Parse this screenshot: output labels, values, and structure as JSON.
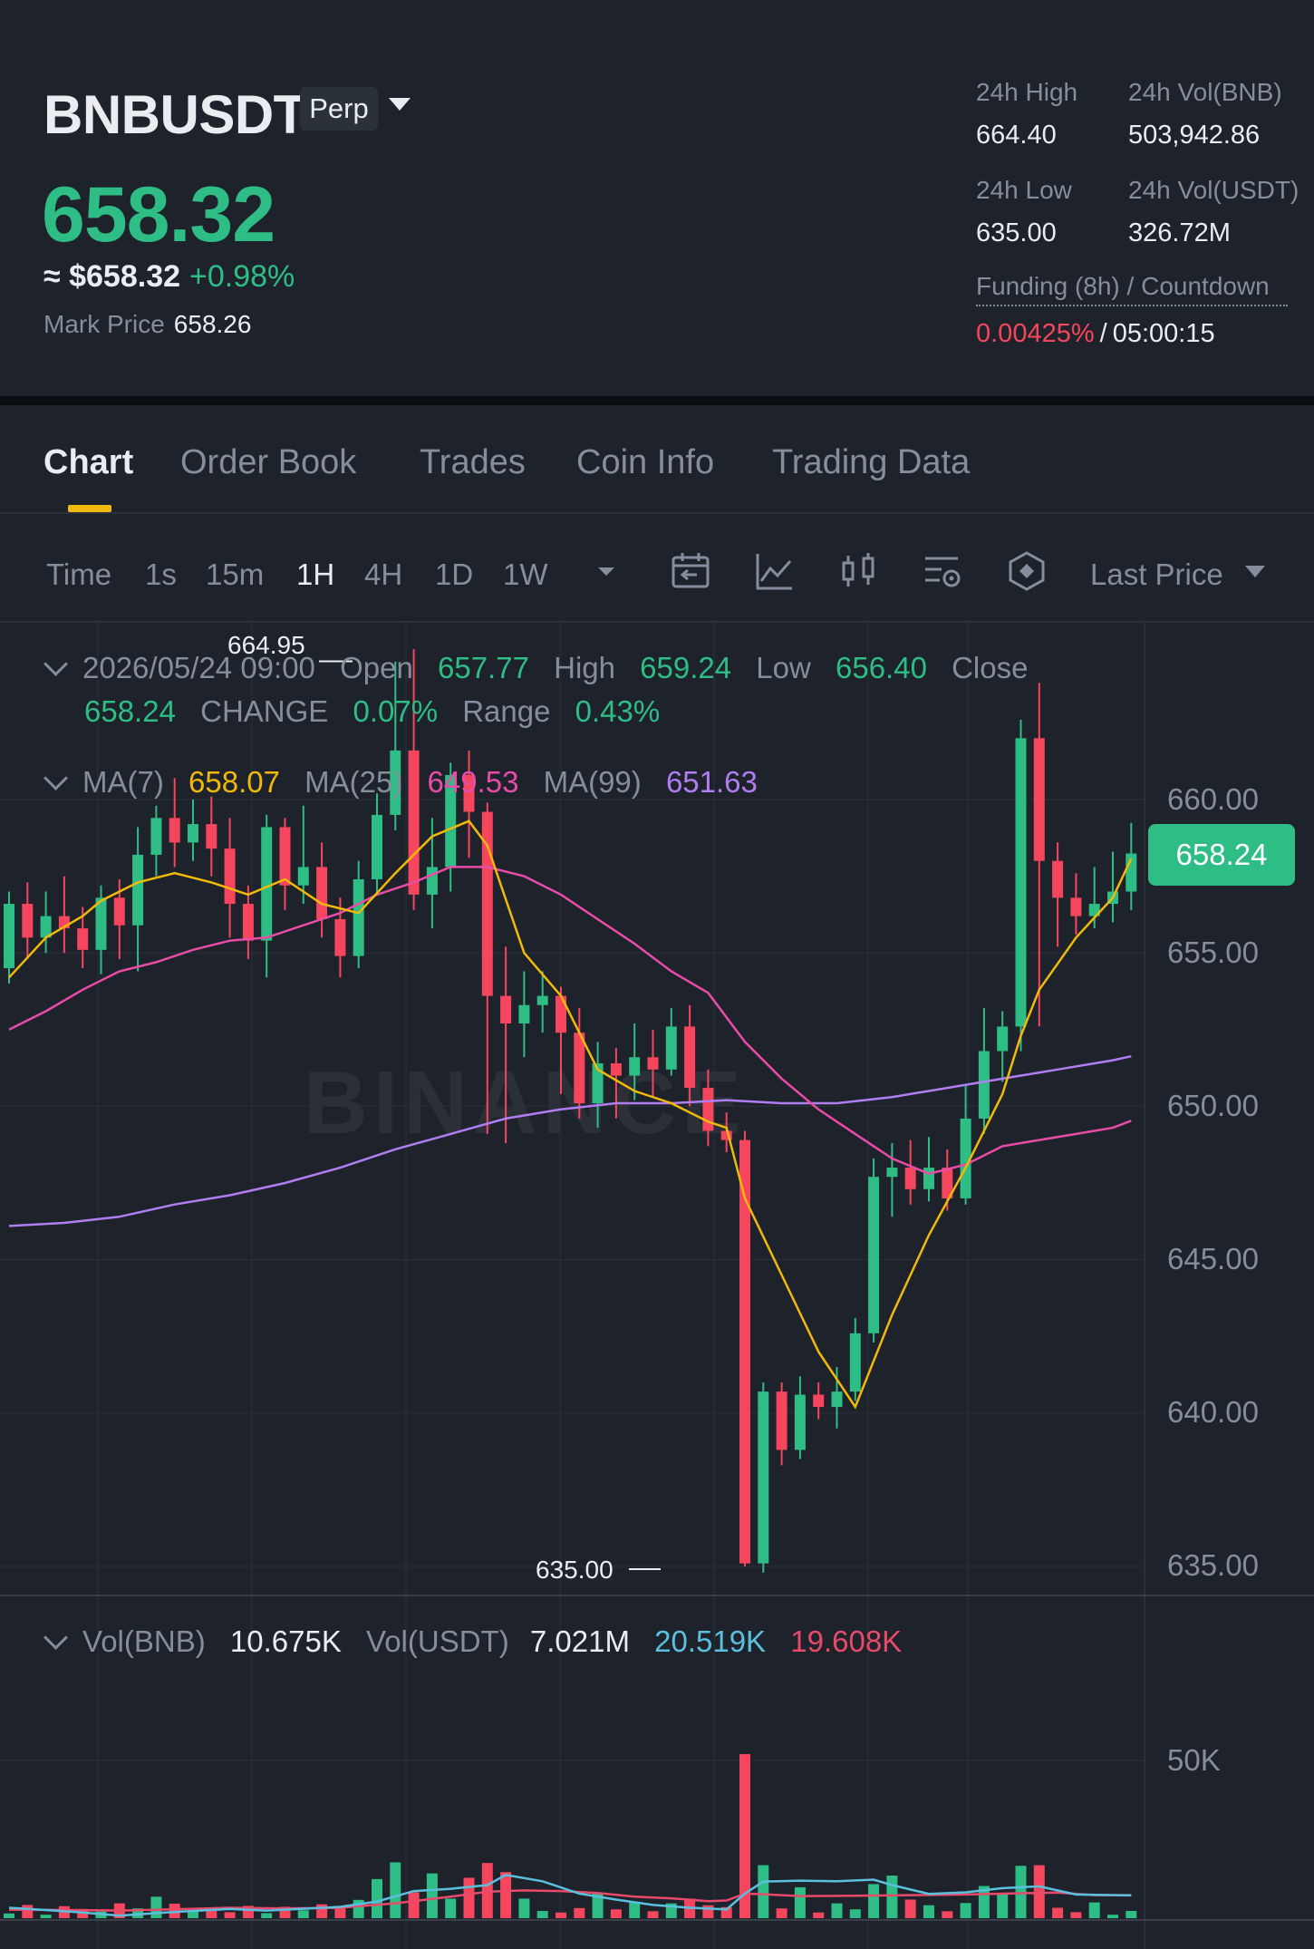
{
  "header": {
    "symbol": "BNBUSDT",
    "contract_type": "Perp",
    "last_price": "658.32",
    "usd_price": "≈ $658.32",
    "change_pct": "+0.98%",
    "mark_price_label": "Mark Price",
    "mark_price": "658.26"
  },
  "stats": {
    "high_label": "24h High",
    "high": "664.40",
    "vol_bnb_label": "24h Vol(BNB)",
    "vol_bnb": "503,942.86",
    "low_label": "24h Low",
    "low": "635.00",
    "vol_usdt_label": "24h Vol(USDT)",
    "vol_usdt": "326.72M",
    "funding_label": "Funding (8h) / Countdown",
    "funding_rate": "0.00425%",
    "funding_sep": "/",
    "countdown": "05:00:15"
  },
  "tabs": [
    "Chart",
    "Order Book",
    "Trades",
    "Coin Info",
    "Trading Data"
  ],
  "toolbar": {
    "timeframes": [
      "Time",
      "1s",
      "15m",
      "1H",
      "4H",
      "1D",
      "1W"
    ],
    "active_timeframe": "1H",
    "price_type": "Last Price",
    "icons": [
      "calendar-icon",
      "indicator-icon",
      "candle-type-icon",
      "settings-icon",
      "depth-icon"
    ]
  },
  "ohlc": {
    "datetime": "2026/05/24 09:00",
    "open_label": "Open",
    "open": "657.77",
    "high_label": "High",
    "high": "659.24",
    "low_label": "Low",
    "low": "656.40",
    "close_label": "Close",
    "close": "658.24",
    "change_label": "CHANGE",
    "change": "0.07%",
    "range_label": "Range",
    "range": "0.43%"
  },
  "ma": {
    "ma7_label": "MA(7)",
    "ma7": "658.07",
    "ma25_label": "MA(25)",
    "ma25": "649.53",
    "ma99_label": "MA(99)",
    "ma99": "651.63"
  },
  "volume_legend": {
    "vol_bnb_label": "Vol(BNB)",
    "vol_bnb": "10.675K",
    "vol_usdt_label": "Vol(USDT)",
    "vol_usdt": "7.021M",
    "ma_a": "20.519K",
    "ma_b": "19.608K"
  },
  "price_axis": [
    "660.00",
    "655.00",
    "650.00",
    "645.00",
    "640.00",
    "635.00"
  ],
  "volume_axis": [
    "50K"
  ],
  "current_price_tag": "658.24",
  "chart_high_label": "664.95",
  "chart_low_label": "635.00",
  "watermark": "BINANCE",
  "colors": {
    "up": "#2ebd85",
    "down": "#f6465d",
    "ma7": "#f0b90b",
    "ma25": "#e84ca7",
    "ma99": "#b07ef0",
    "vol_ma_a": "#5bc0de",
    "vol_ma_b": "#e84a6a"
  },
  "chart_data": {
    "type": "candlestick",
    "price_range": [
      634,
      666.5
    ],
    "volume_range": [
      0,
      55000
    ],
    "candles": [
      [
        654.5,
        656.6,
        654,
        657
      ],
      [
        656.6,
        655.5,
        654.8,
        657.3
      ],
      [
        655.5,
        656.2,
        655,
        657
      ],
      [
        656.2,
        655.8,
        655,
        657.5
      ],
      [
        655.8,
        655.1,
        654.5,
        656.5
      ],
      [
        655.1,
        656.8,
        654.3,
        657.2
      ],
      [
        656.8,
        655.9,
        654.8,
        657.4
      ],
      [
        655.9,
        658.2,
        654.4,
        659.1
      ],
      [
        658.2,
        659.4,
        657.5,
        659.8
      ],
      [
        659.4,
        658.6,
        657.8,
        660.7
      ],
      [
        658.6,
        659.2,
        658,
        660
      ],
      [
        659.2,
        658.4,
        657.5,
        660.1
      ],
      [
        658.4,
        656.6,
        655.5,
        659.4
      ],
      [
        656.6,
        655.4,
        654.8,
        657.2
      ],
      [
        655.4,
        659.1,
        654.2,
        659.5
      ],
      [
        659.1,
        657.2,
        656.4,
        659.4
      ],
      [
        657.2,
        657.8,
        656.6,
        659.8
      ],
      [
        657.8,
        656.1,
        655.5,
        658.6
      ],
      [
        656.1,
        654.9,
        654.2,
        656.8
      ],
      [
        654.9,
        657.4,
        654.5,
        658
      ],
      [
        657.4,
        659.5,
        656.9,
        660.2
      ],
      [
        659.5,
        661.6,
        659,
        664.5
      ],
      [
        661.6,
        656.9,
        656.4,
        664.9
      ],
      [
        656.9,
        657.8,
        655.8,
        659.4
      ],
      [
        657.8,
        660.8,
        657,
        661.2
      ],
      [
        660.8,
        659.6,
        658.1,
        661.6
      ],
      [
        659.6,
        653.6,
        649.1,
        659.9
      ],
      [
        653.6,
        652.7,
        648.8,
        655.2
      ],
      [
        652.7,
        653.3,
        651.6,
        654.4
      ],
      [
        653.3,
        653.6,
        652.4,
        654.4
      ],
      [
        653.6,
        652.4,
        650.4,
        653.9
      ],
      [
        652.4,
        650.1,
        649.6,
        653.2
      ],
      [
        650.1,
        651.4,
        649.3,
        652.1
      ],
      [
        651.4,
        651,
        649.6,
        651.9
      ],
      [
        651,
        651.6,
        650.2,
        652.7
      ],
      [
        651.6,
        651.2,
        650.3,
        652.5
      ],
      [
        651.2,
        652.6,
        651,
        653.2
      ],
      [
        652.6,
        650.6,
        650,
        653.3
      ],
      [
        650.6,
        649.2,
        648.7,
        651.2
      ],
      [
        649.2,
        648.9,
        648.5,
        649.8
      ],
      [
        648.9,
        635.1,
        635,
        649.2
      ],
      [
        635.1,
        640.7,
        634.8,
        641
      ],
      [
        640.7,
        638.8,
        638.3,
        641
      ],
      [
        638.8,
        640.6,
        638.5,
        641.2
      ],
      [
        640.6,
        640.2,
        639.8,
        641
      ],
      [
        640.2,
        640.7,
        639.5,
        641.5
      ],
      [
        640.7,
        642.6,
        640.4,
        643.1
      ],
      [
        642.6,
        647.7,
        642.3,
        648.3
      ],
      [
        647.7,
        648,
        646.4,
        648.8
      ],
      [
        648,
        647.3,
        646.8,
        648.9
      ],
      [
        647.3,
        648,
        646.9,
        649
      ],
      [
        648,
        647,
        646.6,
        648.6
      ],
      [
        647,
        649.6,
        646.8,
        650.7
      ],
      [
        649.6,
        651.8,
        649.1,
        653.2
      ],
      [
        651.8,
        652.6,
        650.8,
        653.1
      ],
      [
        652.6,
        662,
        651.8,
        662.6
      ],
      [
        662,
        658,
        652.6,
        663.8
      ],
      [
        658,
        656.8,
        655.2,
        658.6
      ],
      [
        656.8,
        656.2,
        655.6,
        657.6
      ],
      [
        656.2,
        656.6,
        655.8,
        657.8
      ],
      [
        656.6,
        657,
        656,
        658.3
      ],
      [
        657,
        658.24,
        656.4,
        659.24
      ]
    ],
    "volumes": [
      1500,
      4200,
      1100,
      3800,
      2900,
      2100,
      4700,
      3100,
      6800,
      4600,
      2400,
      2900,
      1900,
      3900,
      1600,
      3600,
      2500,
      4400,
      3100,
      5800,
      12400,
      17700,
      8200,
      14200,
      6200,
      12800,
      17500,
      14600,
      6200,
      2300,
      1800,
      3200,
      7800,
      2800,
      5200,
      2200,
      4700,
      6200,
      4100,
      3500,
      52000,
      16800,
      3100,
      9800,
      1800,
      4700,
      2800,
      10800,
      13500,
      5900,
      4100,
      2200,
      4800,
      10200,
      7600,
      16600,
      16800,
      3300,
      1900,
      5000,
      1100,
      2300
    ],
    "ma7": [
      [
        0,
        654.2
      ],
      [
        2,
        655.5
      ],
      [
        4,
        656.2
      ],
      [
        5,
        656.7
      ],
      [
        7,
        657.3
      ],
      [
        9,
        657.6
      ],
      [
        11,
        657.3
      ],
      [
        13,
        656.9
      ],
      [
        15,
        657.4
      ],
      [
        17,
        656.6
      ],
      [
        19,
        656.3
      ],
      [
        21,
        657.6
      ],
      [
        23,
        658.8
      ],
      [
        25,
        659.3
      ],
      [
        26,
        658.5
      ],
      [
        28,
        655
      ],
      [
        30,
        653.6
      ],
      [
        32,
        651.2
      ],
      [
        34,
        650.5
      ],
      [
        36,
        650.1
      ],
      [
        38,
        649.5
      ],
      [
        39,
        649.3
      ],
      [
        40,
        647
      ],
      [
        42,
        644.5
      ],
      [
        44,
        642
      ],
      [
        46,
        640.2
      ],
      [
        48,
        643.2
      ],
      [
        50,
        645.8
      ],
      [
        52,
        648
      ],
      [
        54,
        650.4
      ],
      [
        55,
        652.3
      ],
      [
        56,
        653.8
      ],
      [
        58,
        655.5
      ],
      [
        60,
        656.8
      ],
      [
        61,
        658.07
      ]
    ],
    "ma25": [
      [
        0,
        652.5
      ],
      [
        2,
        653.1
      ],
      [
        4,
        653.8
      ],
      [
        6,
        654.4
      ],
      [
        8,
        654.7
      ],
      [
        10,
        655.1
      ],
      [
        12,
        655.4
      ],
      [
        14,
        655.5
      ],
      [
        16,
        655.9
      ],
      [
        18,
        656.3
      ],
      [
        20,
        656.9
      ],
      [
        22,
        657.3
      ],
      [
        24,
        657.8
      ],
      [
        26,
        657.8
      ],
      [
        28,
        657.5
      ],
      [
        30,
        656.9
      ],
      [
        32,
        656.1
      ],
      [
        34,
        655.3
      ],
      [
        36,
        654.4
      ],
      [
        38,
        653.7
      ],
      [
        40,
        652.1
      ],
      [
        42,
        650.9
      ],
      [
        44,
        649.9
      ],
      [
        46,
        649.1
      ],
      [
        48,
        648.3
      ],
      [
        50,
        647.8
      ],
      [
        52,
        648.1
      ],
      [
        54,
        648.7
      ],
      [
        56,
        648.9
      ],
      [
        58,
        649.1
      ],
      [
        60,
        649.3
      ],
      [
        61,
        649.53
      ]
    ],
    "ma99": [
      [
        0,
        646.1
      ],
      [
        3,
        646.2
      ],
      [
        6,
        646.4
      ],
      [
        9,
        646.8
      ],
      [
        12,
        647.1
      ],
      [
        15,
        647.5
      ],
      [
        18,
        648
      ],
      [
        21,
        648.6
      ],
      [
        24,
        649.1
      ],
      [
        27,
        649.6
      ],
      [
        30,
        649.9
      ],
      [
        33,
        650.1
      ],
      [
        36,
        650.1
      ],
      [
        39,
        650.2
      ],
      [
        42,
        650.1
      ],
      [
        45,
        650.1
      ],
      [
        48,
        650.3
      ],
      [
        51,
        650.6
      ],
      [
        54,
        650.9
      ],
      [
        57,
        651.2
      ],
      [
        60,
        651.5
      ],
      [
        61,
        651.63
      ]
    ],
    "vol_ma_a": [
      [
        0,
        3300
      ],
      [
        2,
        2600
      ],
      [
        4,
        1800
      ],
      [
        6,
        800
      ],
      [
        8,
        1600
      ],
      [
        10,
        2300
      ],
      [
        12,
        2900
      ],
      [
        14,
        2400
      ],
      [
        16,
        3000
      ],
      [
        18,
        3600
      ],
      [
        20,
        5300
      ],
      [
        22,
        8600
      ],
      [
        24,
        9300
      ],
      [
        26,
        10500
      ],
      [
        27,
        13700
      ],
      [
        29,
        11700
      ],
      [
        31,
        7800
      ],
      [
        33,
        5900
      ],
      [
        35,
        4200
      ],
      [
        37,
        3300
      ],
      [
        39,
        2800
      ],
      [
        40,
        7800
      ],
      [
        41,
        11600
      ],
      [
        43,
        11900
      ],
      [
        45,
        11700
      ],
      [
        47,
        12200
      ],
      [
        48,
        10500
      ],
      [
        50,
        7700
      ],
      [
        52,
        8200
      ],
      [
        54,
        9500
      ],
      [
        56,
        10100
      ],
      [
        58,
        7500
      ],
      [
        61,
        7200
      ]
    ],
    "vol_ma_b": [
      [
        0,
        2700
      ],
      [
        3,
        2600
      ],
      [
        6,
        2400
      ],
      [
        9,
        2800
      ],
      [
        12,
        3300
      ],
      [
        15,
        3100
      ],
      [
        18,
        3300
      ],
      [
        21,
        4700
      ],
      [
        24,
        6800
      ],
      [
        26,
        8400
      ],
      [
        28,
        8800
      ],
      [
        30,
        8600
      ],
      [
        32,
        8000
      ],
      [
        34,
        6800
      ],
      [
        36,
        6300
      ],
      [
        38,
        5400
      ],
      [
        39,
        5600
      ],
      [
        40,
        7800
      ],
      [
        41,
        7600
      ],
      [
        43,
        7000
      ],
      [
        46,
        7100
      ],
      [
        49,
        7300
      ],
      [
        52,
        7500
      ],
      [
        55,
        7900
      ],
      [
        57,
        8100
      ],
      [
        59,
        7300
      ],
      [
        61,
        7300
      ]
    ]
  }
}
